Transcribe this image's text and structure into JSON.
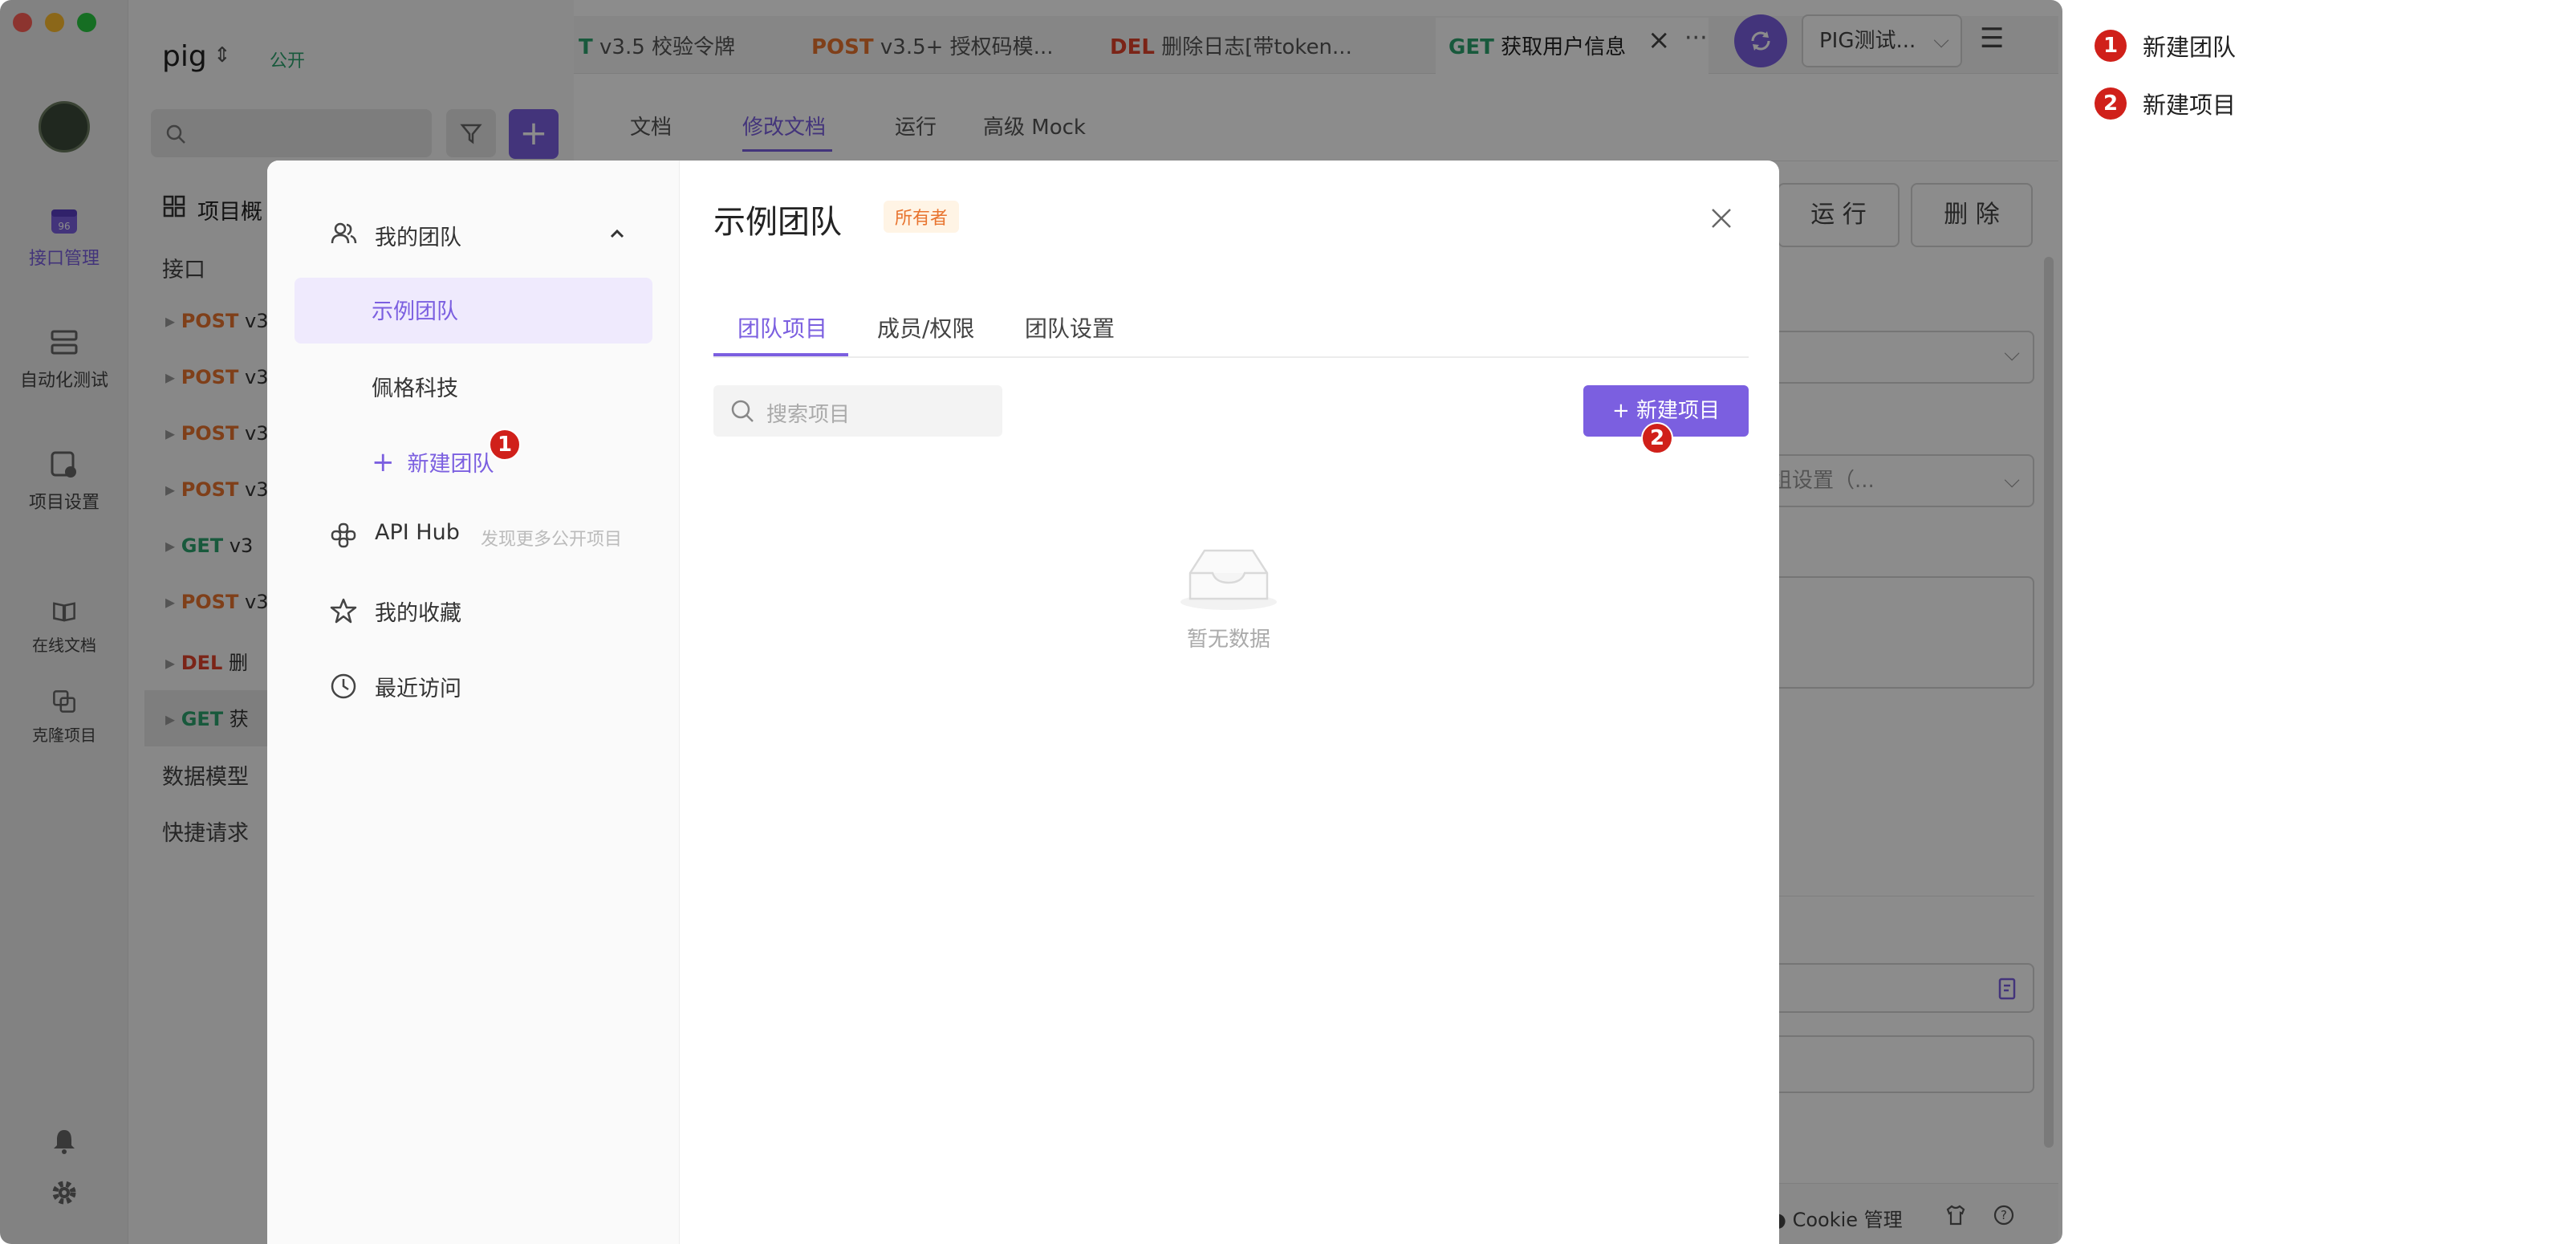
{
  "app": {
    "project_name": "pig",
    "visibility": "公开",
    "env_selector": "PIG测试..."
  },
  "sidebar": {
    "items": [
      {
        "label": "接口管理",
        "icon": "api-manage-icon",
        "active": true
      },
      {
        "label": "自动化测试",
        "icon": "automation-test-icon",
        "active": false
      },
      {
        "label": "项目设置",
        "icon": "project-settings-icon",
        "active": false
      },
      {
        "label": "在线文档",
        "icon": "online-doc-icon",
        "active": false
      },
      {
        "label": "克隆项目",
        "icon": "clone-project-icon",
        "active": false
      }
    ]
  },
  "panel": {
    "overview": "项目概",
    "api_group": "接口",
    "tree": [
      {
        "method": "POST",
        "text": "v3"
      },
      {
        "method": "POST",
        "text": "v3"
      },
      {
        "method": "POST",
        "text": "v3"
      },
      {
        "method": "POST",
        "text": "v3"
      },
      {
        "method": "GET",
        "text": "v3"
      },
      {
        "method": "POST",
        "text": "v3"
      },
      {
        "method": "DEL",
        "text": "删"
      },
      {
        "method": "GET",
        "text": "获"
      }
    ],
    "data_model": "数据模型",
    "quick_request": "快捷请求"
  },
  "tabs": [
    {
      "method": "T",
      "title": "v3.5 校验令牌"
    },
    {
      "method": "POST",
      "title": "v3.5+ 授权码模..."
    },
    {
      "method": "DEL",
      "title": "删除日志[带token..."
    },
    {
      "method": "GET",
      "title": "获取用户信息",
      "active": true
    }
  ],
  "subtabs": [
    "文档",
    "修改文档",
    "运行",
    "高级 Mock"
  ],
  "main": {
    "run_button": "运 行",
    "delete_button": "删 除",
    "parent_group_hint": "父级分组设置（...",
    "cookie_manage": "Cookie 管理"
  },
  "modal": {
    "my_team": "我的团队",
    "teams": [
      "示例团队",
      "佩格科技"
    ],
    "new_team": "新建团队",
    "api_hub": "API Hub",
    "api_hub_hint": "发现更多公开项目",
    "favorites": "我的收藏",
    "recent": "最近访问",
    "title": "示例团队",
    "role_badge": "所有者",
    "tabs": [
      "团队项目",
      "成员/权限",
      "团队设置"
    ],
    "search_placeholder": "搜索项目",
    "new_project_button": "+ 新建项目",
    "empty_text": "暂无数据"
  },
  "legend": [
    {
      "num": "1",
      "text": "新建团队"
    },
    {
      "num": "2",
      "text": "新建项目"
    }
  ]
}
